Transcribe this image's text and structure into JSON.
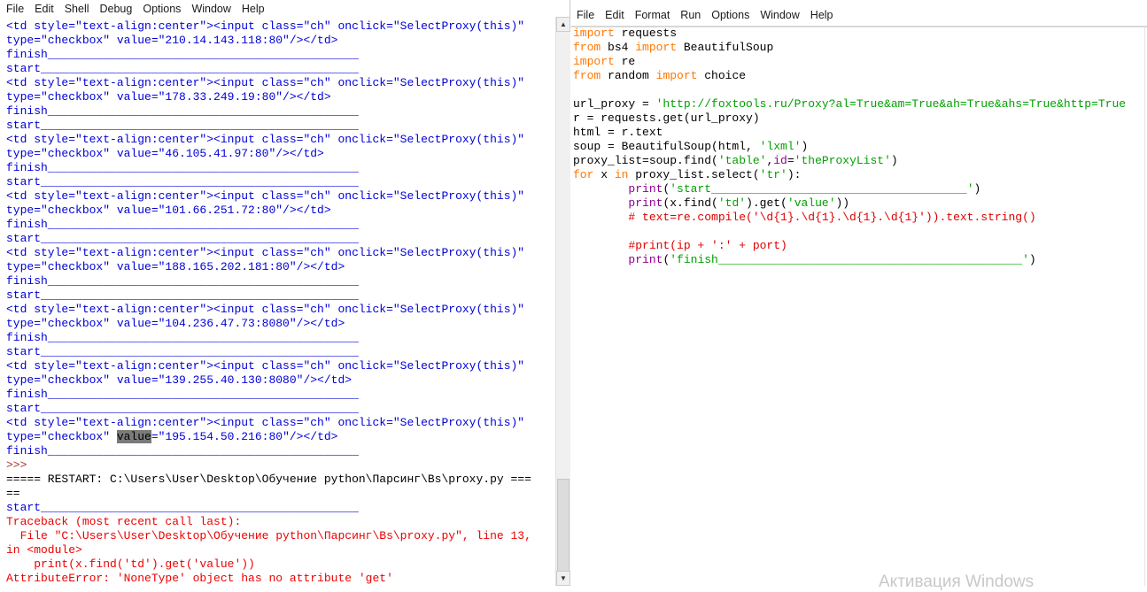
{
  "shell": {
    "menu": [
      "File",
      "Edit",
      "Shell",
      "Debug",
      "Options",
      "Window",
      "Help"
    ],
    "lines": [
      [
        [
          "<td style=\"text-align:center\"><input class=\"ch\" onclick=\"SelectProxy(this)\"",
          "out"
        ]
      ],
      [
        [
          "type=\"checkbox\" value=\"210.14.143.118:80\"/></td>",
          "out"
        ]
      ],
      [
        [
          "finish_____________________________________________",
          "out"
        ]
      ],
      [
        [
          "start______________________________________________",
          "out"
        ]
      ],
      [
        [
          "<td style=\"text-align:center\"><input class=\"ch\" onclick=\"SelectProxy(this)\"",
          "out"
        ]
      ],
      [
        [
          "type=\"checkbox\" value=\"178.33.249.19:80\"/></td>",
          "out"
        ]
      ],
      [
        [
          "finish_____________________________________________",
          "out"
        ]
      ],
      [
        [
          "start______________________________________________",
          "out"
        ]
      ],
      [
        [
          "<td style=\"text-align:center\"><input class=\"ch\" onclick=\"SelectProxy(this)\"",
          "out"
        ]
      ],
      [
        [
          "type=\"checkbox\" value=\"46.105.41.97:80\"/></td>",
          "out"
        ]
      ],
      [
        [
          "finish_____________________________________________",
          "out"
        ]
      ],
      [
        [
          "start______________________________________________",
          "out"
        ]
      ],
      [
        [
          "<td style=\"text-align:center\"><input class=\"ch\" onclick=\"SelectProxy(this)\"",
          "out"
        ]
      ],
      [
        [
          "type=\"checkbox\" value=\"101.66.251.72:80\"/></td>",
          "out"
        ]
      ],
      [
        [
          "finish_____________________________________________",
          "out"
        ]
      ],
      [
        [
          "start______________________________________________",
          "out"
        ]
      ],
      [
        [
          "<td style=\"text-align:center\"><input class=\"ch\" onclick=\"SelectProxy(this)\"",
          "out"
        ]
      ],
      [
        [
          "type=\"checkbox\" value=\"188.165.202.181:80\"/></td>",
          "out"
        ]
      ],
      [
        [
          "finish_____________________________________________",
          "out"
        ]
      ],
      [
        [
          "start______________________________________________",
          "out"
        ]
      ],
      [
        [
          "<td style=\"text-align:center\"><input class=\"ch\" onclick=\"SelectProxy(this)\"",
          "out"
        ]
      ],
      [
        [
          "type=\"checkbox\" value=\"104.236.47.73:8080\"/></td>",
          "out"
        ]
      ],
      [
        [
          "finish_____________________________________________",
          "out"
        ]
      ],
      [
        [
          "start______________________________________________",
          "out"
        ]
      ],
      [
        [
          "<td style=\"text-align:center\"><input class=\"ch\" onclick=\"SelectProxy(this)\"",
          "out"
        ]
      ],
      [
        [
          "type=\"checkbox\" value=\"139.255.40.130:8080\"/></td>",
          "out"
        ]
      ],
      [
        [
          "finish_____________________________________________",
          "out"
        ]
      ],
      [
        [
          "start______________________________________________",
          "out"
        ]
      ],
      [
        [
          "<td style=\"text-align:center\"><input class=\"ch\" onclick=\"SelectProxy(this)\"",
          "out"
        ]
      ],
      [
        [
          "type=\"checkbox\" ",
          "out"
        ],
        [
          "value",
          "out hl"
        ],
        [
          "=\"195.154.50.216:80\"/></td>",
          "out"
        ]
      ],
      [
        [
          "finish_____________________________________________",
          "out"
        ]
      ],
      [
        [
          ">>> ",
          "prompt"
        ]
      ],
      [
        [
          "===== RESTART: C:\\Users\\User\\Desktop\\Обучение python\\Парсинг\\Bs\\proxy.py ===",
          "plain"
        ]
      ],
      [
        [
          "==",
          "plain"
        ]
      ],
      [
        [
          "start______________________________________________",
          "out"
        ]
      ],
      [
        [
          "Traceback (most recent call last):",
          "err"
        ]
      ],
      [
        [
          "  File \"C:\\Users\\User\\Desktop\\Обучение python\\Парсинг\\Bs\\proxy.py\", line 13,",
          "err"
        ]
      ],
      [
        [
          "in <module>",
          "err"
        ]
      ],
      [
        [
          "    print(x.find('td').get('value'))",
          "err"
        ]
      ],
      [
        [
          "AttributeError: 'NoneType' object has no attribute 'get'",
          "err"
        ]
      ]
    ]
  },
  "editor": {
    "menu": [
      "File",
      "Edit",
      "Format",
      "Run",
      "Options",
      "Window",
      "Help"
    ],
    "lines": [
      [
        [
          "import",
          "kw"
        ],
        [
          " requests",
          "plain"
        ]
      ],
      [
        [
          "from",
          "kw"
        ],
        [
          " bs4 ",
          "plain"
        ],
        [
          "import",
          "kw"
        ],
        [
          " BeautifulSoup",
          "plain"
        ]
      ],
      [
        [
          "import",
          "kw"
        ],
        [
          " re",
          "plain"
        ]
      ],
      [
        [
          "from",
          "kw"
        ],
        [
          " random ",
          "plain"
        ],
        [
          "import",
          "kw"
        ],
        [
          " choice",
          "plain"
        ]
      ],
      [
        [
          "",
          "plain"
        ]
      ],
      [
        [
          "url_proxy = ",
          "plain"
        ],
        [
          "'http://foxtools.ru/Proxy?al=True&am=True&ah=True&ahs=True&http=True",
          "str"
        ]
      ],
      [
        [
          "r = requests.get(url_proxy)",
          "plain"
        ]
      ],
      [
        [
          "html = r.text",
          "plain"
        ]
      ],
      [
        [
          "soup = BeautifulSoup(html, ",
          "plain"
        ],
        [
          "'lxml'",
          "str"
        ],
        [
          ")",
          "plain"
        ]
      ],
      [
        [
          "proxy_list=soup.find(",
          "plain"
        ],
        [
          "'table'",
          "str"
        ],
        [
          ",",
          "plain"
        ],
        [
          "id",
          "bi"
        ],
        [
          "=",
          "plain"
        ],
        [
          "'theProxyList'",
          "str"
        ],
        [
          ")",
          "plain"
        ]
      ],
      [
        [
          "for",
          "kw"
        ],
        [
          " x ",
          "plain"
        ],
        [
          "in",
          "kw"
        ],
        [
          " proxy_list.select(",
          "plain"
        ],
        [
          "'tr'",
          "str"
        ],
        [
          "):",
          "plain"
        ]
      ],
      [
        [
          "        ",
          "plain"
        ],
        [
          "print",
          "bi"
        ],
        [
          "(",
          "plain"
        ],
        [
          "'start_____________________________________'",
          "str"
        ],
        [
          ")",
          "plain"
        ]
      ],
      [
        [
          "        ",
          "plain"
        ],
        [
          "print",
          "bi"
        ],
        [
          "(x.find(",
          "plain"
        ],
        [
          "'td'",
          "str"
        ],
        [
          ").get(",
          "plain"
        ],
        [
          "'value'",
          "str"
        ],
        [
          "))",
          "plain"
        ]
      ],
      [
        [
          "        # text=re.compile('\\d{1}.\\d{1}.\\d{1}.\\d{1}')).text.string()",
          "cm"
        ]
      ],
      [
        [
          "",
          "plain"
        ]
      ],
      [
        [
          "        #print(ip + ':' + port)",
          "cm"
        ]
      ],
      [
        [
          "        ",
          "plain"
        ],
        [
          "print",
          "bi"
        ],
        [
          "(",
          "plain"
        ],
        [
          "'finish____________________________________________'",
          "str"
        ],
        [
          ")",
          "plain"
        ]
      ]
    ]
  },
  "watermark": "Активация Windows"
}
